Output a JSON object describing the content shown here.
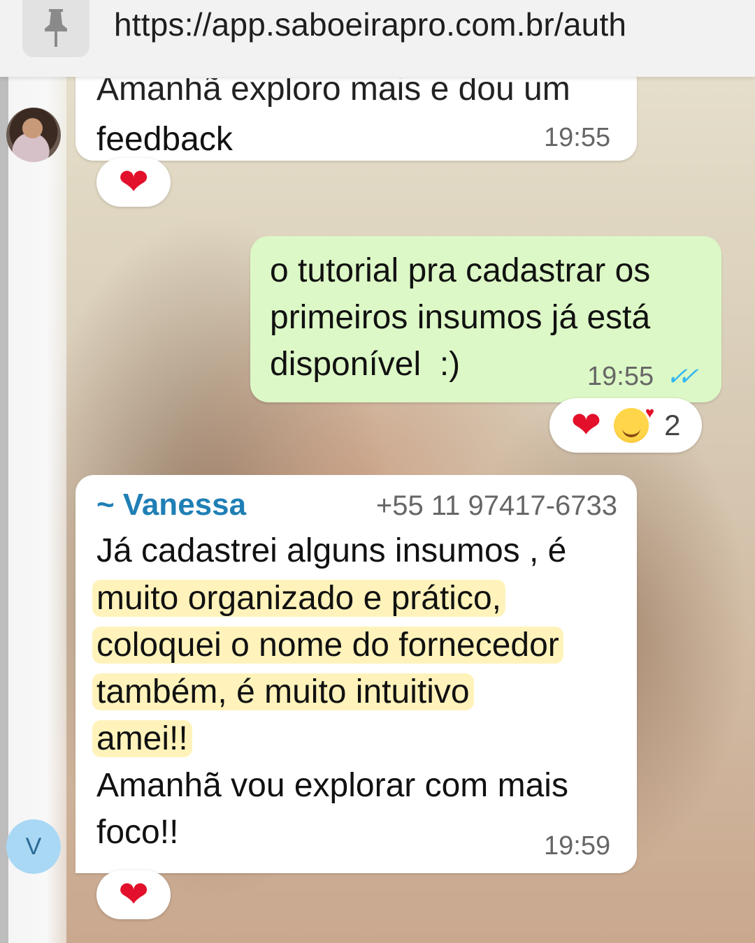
{
  "browser": {
    "url": "https://app.saboeirapro.com.br/auth",
    "pin_icon": "pin-icon"
  },
  "messages": [
    {
      "id": "msg1",
      "direction": "incoming",
      "partial_text": "Amanhã exploro mais e dou um",
      "text": "feedback",
      "time": "19:55",
      "reactions": [
        "❤️"
      ]
    },
    {
      "id": "msg2",
      "direction": "outgoing",
      "text_lines": [
        "o tutorial pra cadastrar os",
        "primeiros insumos já está",
        "disponível  :)"
      ],
      "time": "19:55",
      "status": "read",
      "reactions": [
        "❤️",
        "🥰"
      ],
      "reaction_count": "2"
    },
    {
      "id": "msg3",
      "direction": "incoming",
      "sender": "~ Vanessa",
      "sender_phone": "+55 11 97417-6733",
      "line1": "Já cadastrei alguns insumos , é",
      "highlighted_lines": [
        "muito organizado e prático,",
        "coloquei o nome do fornecedor",
        "também, é muito intuitivo",
        "amei!!"
      ],
      "tail_lines": [
        "Amanhã vou explorar com mais",
        "foco!!"
      ],
      "time": "19:59",
      "avatar_initial": "V",
      "reactions": [
        "❤️"
      ]
    }
  ],
  "colors": {
    "outgoing_bubble": "#dcf8c6",
    "incoming_bubble": "#ffffff",
    "sender_name": "#1f7fb5",
    "read_ticks": "#34b7f1",
    "highlight": "#ffec96"
  }
}
